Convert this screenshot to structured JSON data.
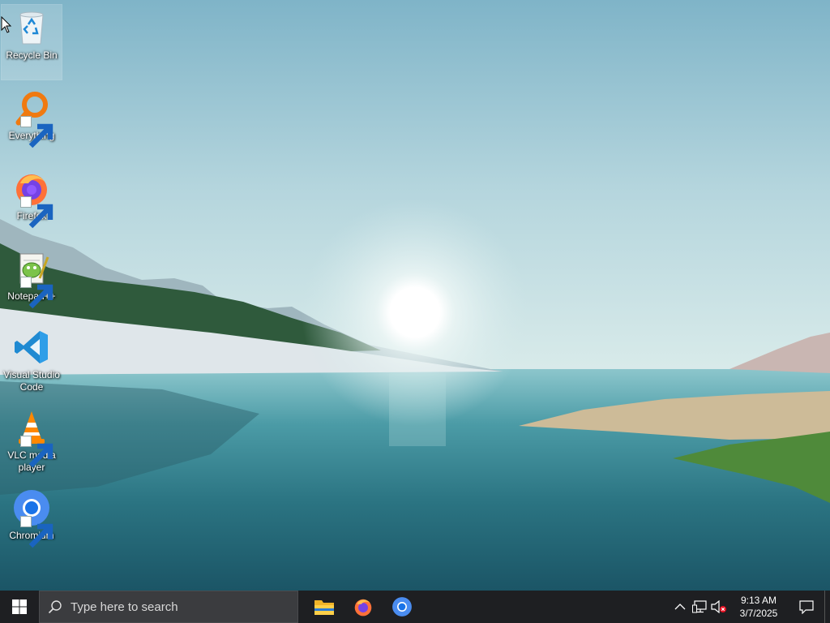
{
  "desktop": {
    "icons": [
      {
        "label": "Recycle Bin",
        "icon": "recycle-bin-icon",
        "selected": true
      },
      {
        "label": "Everything",
        "icon": "everything-search-icon"
      },
      {
        "label": "Firefox",
        "icon": "firefox-icon"
      },
      {
        "label": "Notepad++",
        "icon": "notepad-plus-plus-icon"
      },
      {
        "label": "Visual Studio Code",
        "icon": "vscode-icon"
      },
      {
        "label": "VLC media player",
        "icon": "vlc-icon"
      },
      {
        "label": "Chromium",
        "icon": "chromium-icon"
      }
    ]
  },
  "taskbar": {
    "search_placeholder": "Type here to search",
    "pinned_apps": [
      "File Explorer",
      "Firefox",
      "Chromium"
    ],
    "clock": {
      "time": "9:13 AM",
      "date": "3/7/2025"
    },
    "tray_icons": [
      "chevron-up-icon",
      "network-icon",
      "volume-muted-icon"
    ]
  },
  "colors": {
    "taskbar_bg": "#1e1f22",
    "search_bg": "#3b3c3f",
    "accent_blue": "#0078d4"
  }
}
